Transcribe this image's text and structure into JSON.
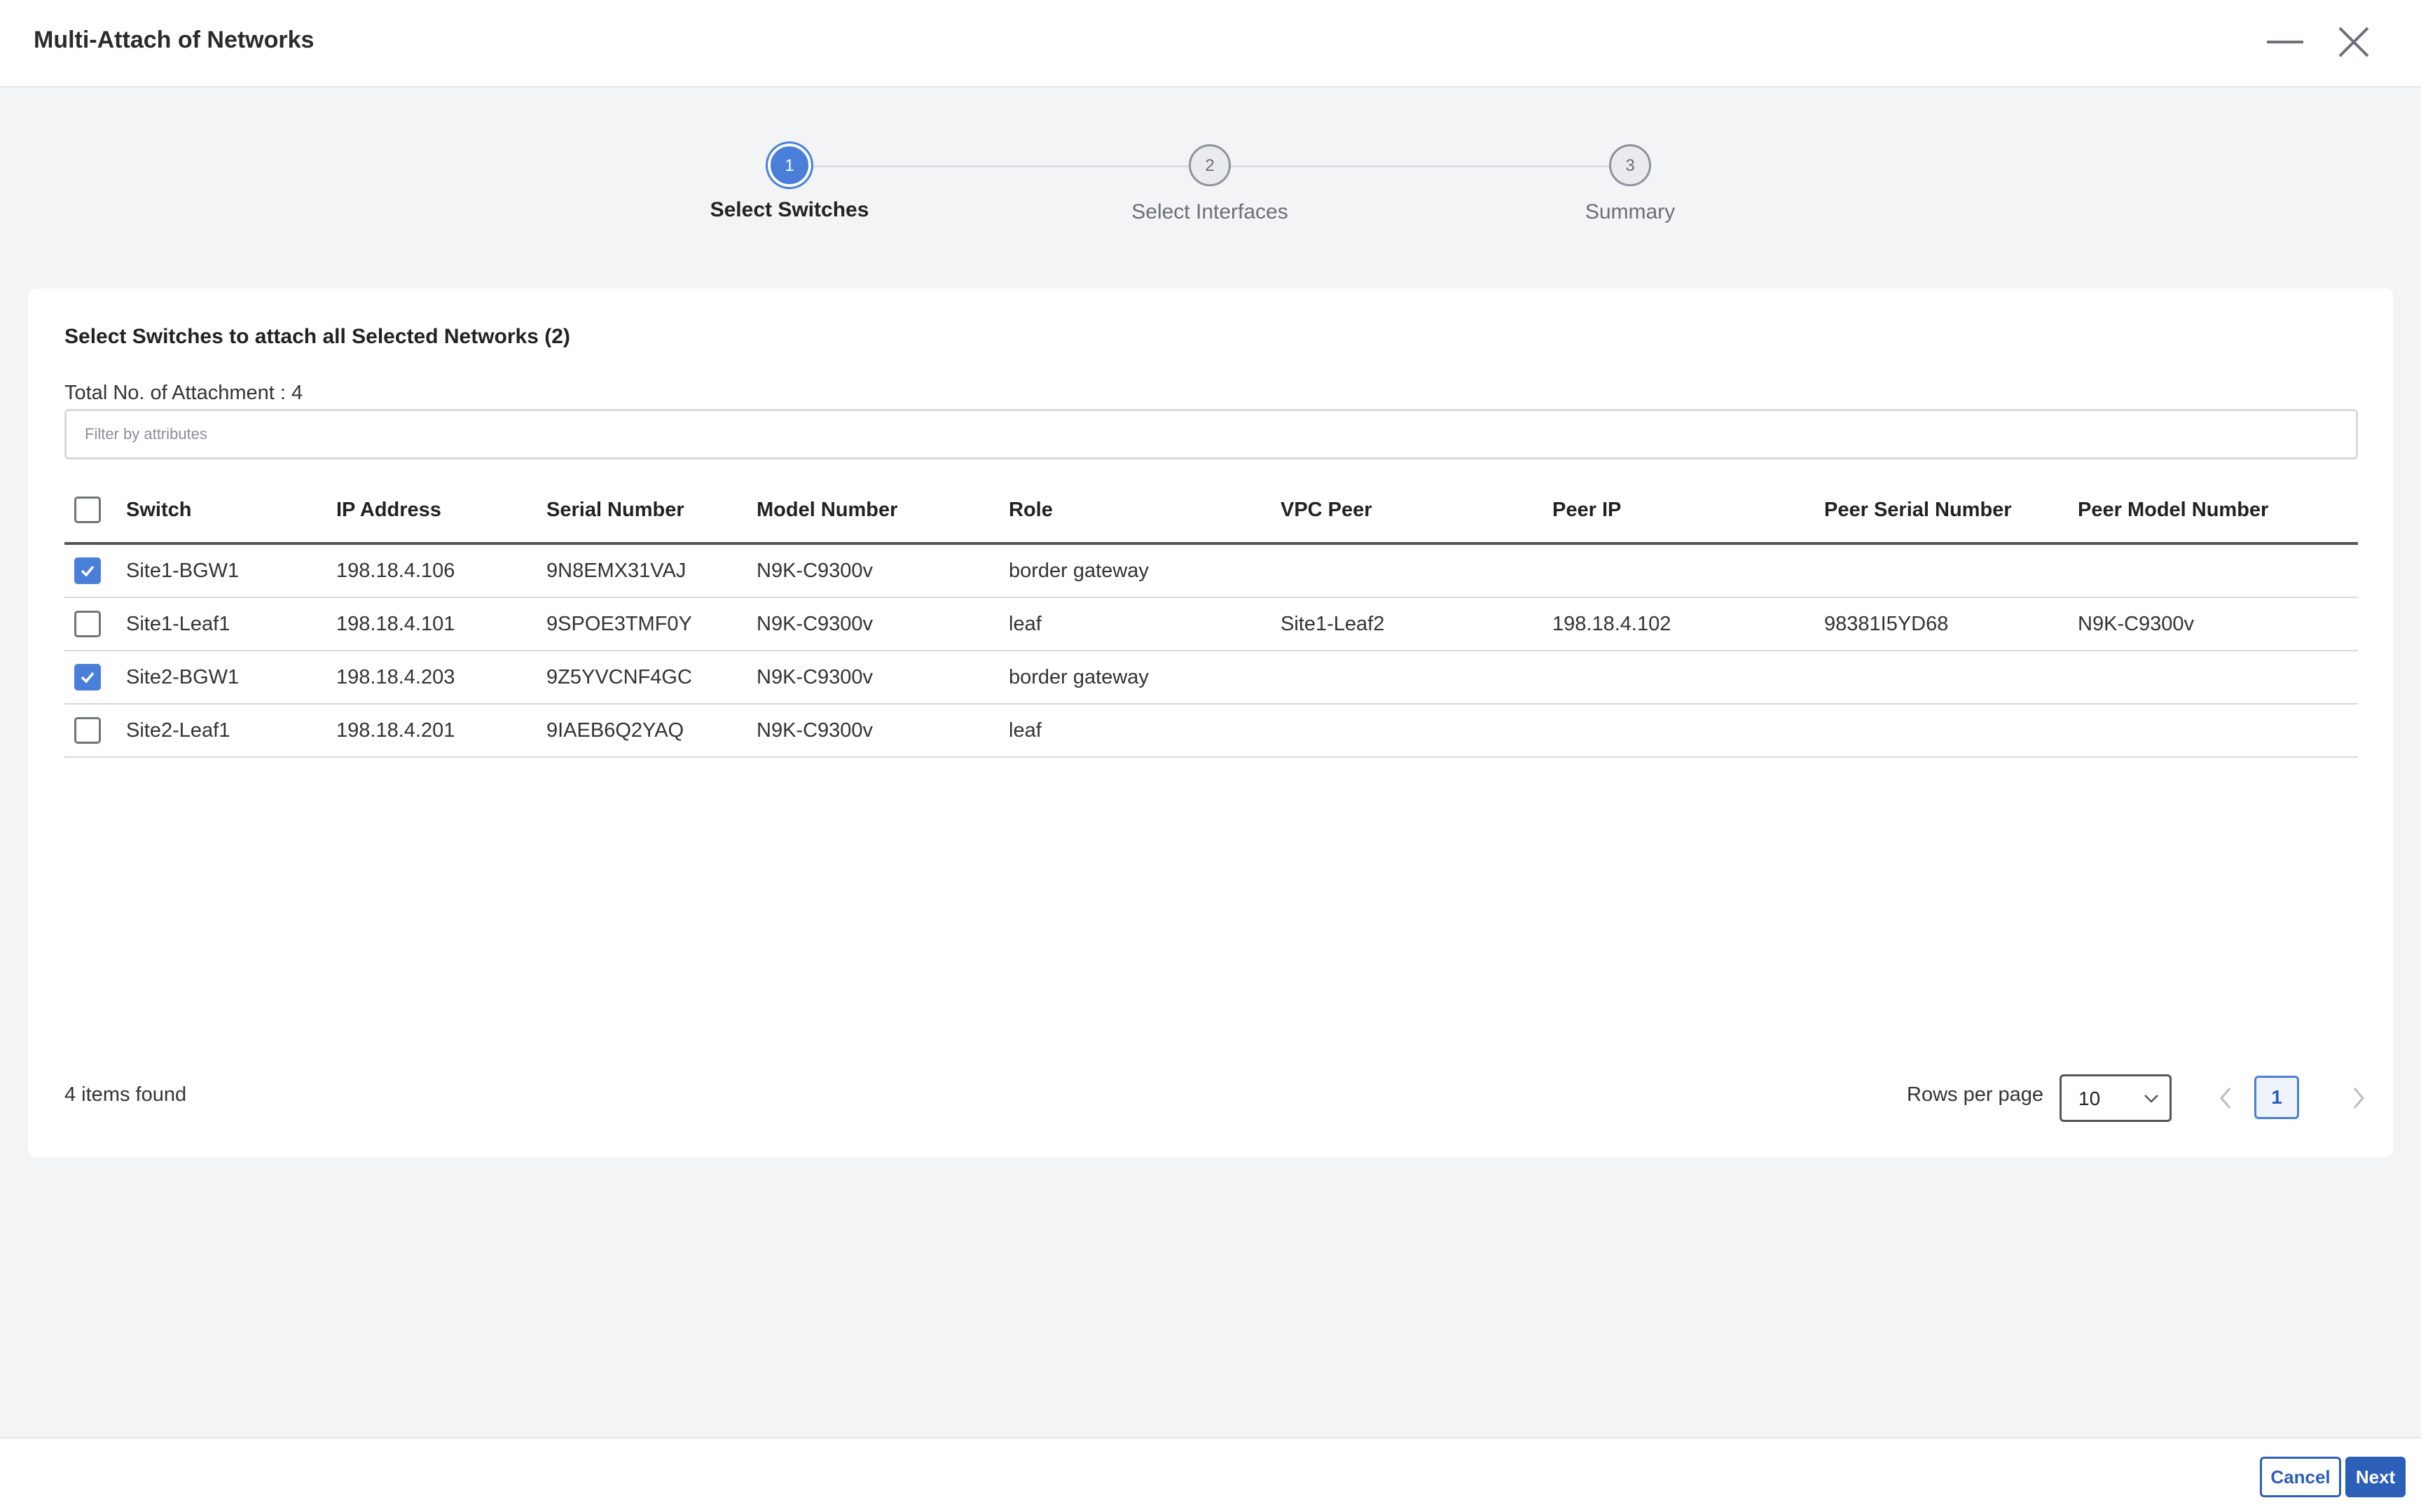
{
  "window": {
    "title": "Multi-Attach of Networks"
  },
  "stepper": {
    "steps": [
      {
        "number": "1",
        "label": "Select Switches",
        "state": "active"
      },
      {
        "number": "2",
        "label": "Select Interfaces",
        "state": "pending"
      },
      {
        "number": "3",
        "label": "Summary",
        "state": "pending"
      }
    ]
  },
  "card": {
    "heading": "Select Switches to attach all Selected Networks (2)",
    "total_attachments": "Total No. of Attachment : 4",
    "filter_placeholder": "Filter by attributes"
  },
  "table": {
    "columns": [
      "Switch",
      "IP Address",
      "Serial Number",
      "Model Number",
      "Role",
      "VPC Peer",
      "Peer IP",
      "Peer Serial Number",
      "Peer Model Number"
    ],
    "select_all_checked": false,
    "rows": [
      {
        "checked": true,
        "cells": [
          "Site1-BGW1",
          "198.18.4.106",
          "9N8EMX31VAJ",
          "N9K-C9300v",
          "border gateway",
          "",
          "",
          "",
          ""
        ]
      },
      {
        "checked": false,
        "cells": [
          "Site1-Leaf1",
          "198.18.4.101",
          "9SPOE3TMF0Y",
          "N9K-C9300v",
          "leaf",
          "Site1-Leaf2",
          "198.18.4.102",
          "98381I5YD68",
          "N9K-C9300v"
        ]
      },
      {
        "checked": true,
        "cells": [
          "Site2-BGW1",
          "198.18.4.203",
          "9Z5YVCNF4GC",
          "N9K-C9300v",
          "border gateway",
          "",
          "",
          "",
          ""
        ]
      },
      {
        "checked": false,
        "cells": [
          "Site2-Leaf1",
          "198.18.4.201",
          "9IAEB6Q2YAQ",
          "N9K-C9300v",
          "leaf",
          "",
          "",
          "",
          ""
        ]
      }
    ]
  },
  "pagination": {
    "items_found": "4 items found",
    "rows_per_page_label": "Rows per page",
    "rows_per_page_value": "10",
    "current_page": "1"
  },
  "footer": {
    "cancel_label": "Cancel",
    "next_label": "Next"
  },
  "colors": {
    "accent": "#4a7fd9",
    "primary_button": "#2b5fb8",
    "background": "#f3f4f6"
  },
  "icons": [
    "minimize-icon",
    "close-icon",
    "checkmark-icon",
    "chevron-down-icon",
    "chevron-left-icon",
    "chevron-right-icon"
  ]
}
